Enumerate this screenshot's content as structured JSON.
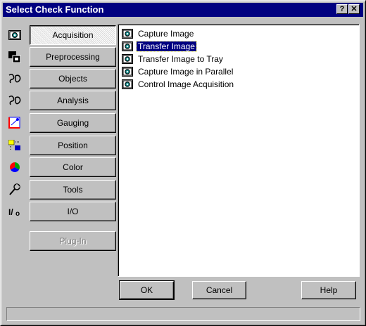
{
  "window": {
    "title": "Select Check Function",
    "help_button": "?",
    "close_button": "✕"
  },
  "categories": [
    {
      "label": "Acquisition",
      "icon": "camera-icon",
      "state": "pressed"
    },
    {
      "label": "Preprocessing",
      "icon": "preprocessing-icon",
      "state": "normal"
    },
    {
      "label": "Objects",
      "icon": "objects-icon",
      "state": "normal"
    },
    {
      "label": "Analysis",
      "icon": "analysis-icon",
      "state": "normal"
    },
    {
      "label": "Gauging",
      "icon": "gauging-icon",
      "state": "normal"
    },
    {
      "label": "Position",
      "icon": "position-icon",
      "state": "normal"
    },
    {
      "label": "Color",
      "icon": "color-wheel-icon",
      "state": "normal"
    },
    {
      "label": "Tools",
      "icon": "tools-icon",
      "state": "normal"
    },
    {
      "label": "I/O",
      "icon": "io-icon",
      "state": "normal"
    }
  ],
  "plugin_button": {
    "label": "Plug-In",
    "state": "disabled"
  },
  "functions": [
    {
      "label": "Capture Image",
      "selected": false
    },
    {
      "label": "Transfer Image",
      "selected": true
    },
    {
      "label": "Transfer Image to Tray",
      "selected": false
    },
    {
      "label": "Capture Image in Parallel",
      "selected": false
    },
    {
      "label": "Control Image Acquisition",
      "selected": false
    }
  ],
  "buttons": {
    "ok": "OK",
    "cancel": "Cancel",
    "help": "Help"
  },
  "status_text": "",
  "colors": {
    "title_bar": "#000080",
    "face": "#c0c0c0",
    "selection": "#000080",
    "camera_icon_green": "#008080"
  }
}
